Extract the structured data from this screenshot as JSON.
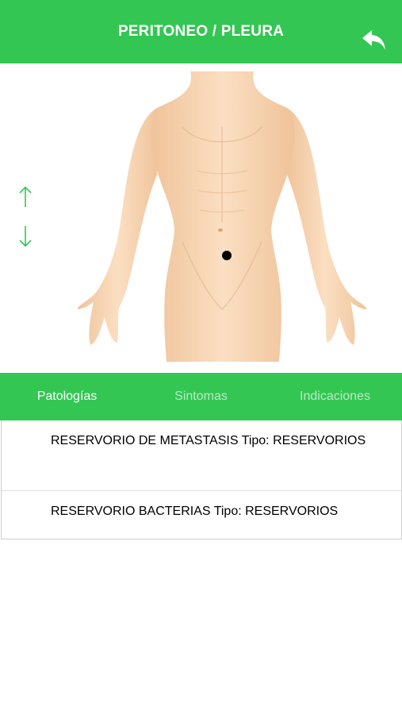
{
  "header": {
    "title": "PERITONEO / PLEURA",
    "back_icon": "reply-arrow-icon"
  },
  "body_view": {
    "image": "human-body-front",
    "marker": "location-dot",
    "nav_up_icon": "arrow-up-icon",
    "nav_down_icon": "arrow-down-icon"
  },
  "tabs": [
    {
      "label": "Patologías",
      "active": true
    },
    {
      "label": "Sintomas",
      "active": false
    },
    {
      "label": "Indicaciones",
      "active": false
    }
  ],
  "list": [
    {
      "text": "RESERVORIO DE METASTASIS Tipo: RESERVORIOS"
    },
    {
      "text": "RESERVORIO BACTERIAS Tipo: RESERVORIOS"
    }
  ],
  "colors": {
    "accent": "#33c653",
    "inactive_tab": "#b7ecc3",
    "skin": "#f6d3b0"
  }
}
